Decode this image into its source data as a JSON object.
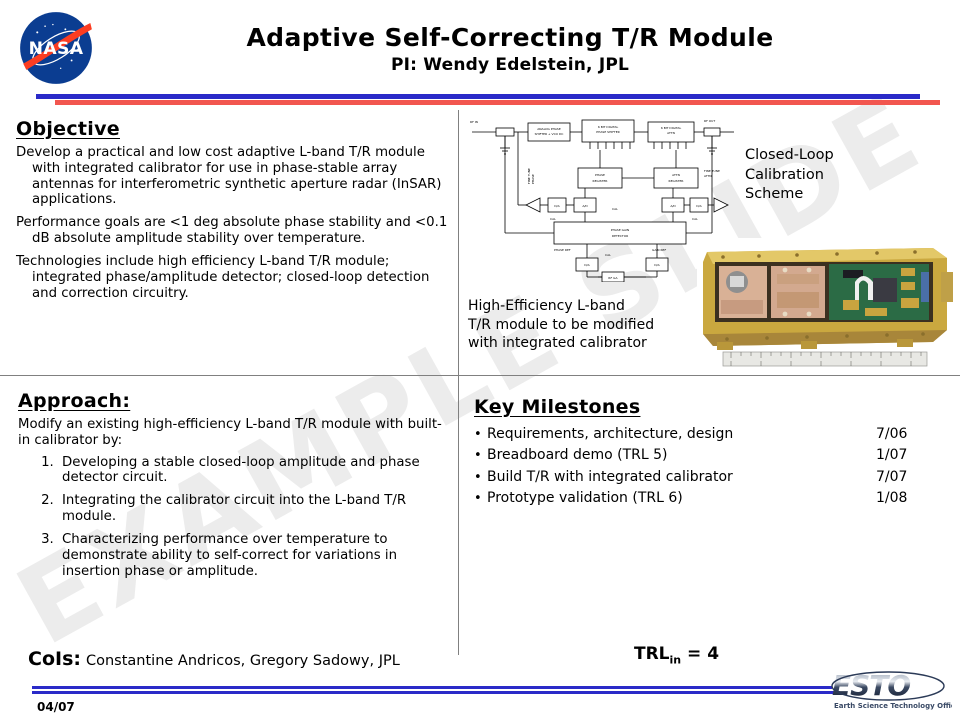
{
  "header": {
    "nasa_logo_alt": "NASA",
    "title": "Adaptive Self-Correcting T/R Module",
    "subtitle": "PI: Wendy Edelstein, JPL"
  },
  "watermark": {
    "text": "EXAMPLE SLIDE"
  },
  "objective": {
    "heading": "Objective",
    "paragraphs": [
      "Develop a practical and low cost  adaptive L-band T/R module with integrated calibrator for use in phase-stable array antennas for interferometric synthetic aperture radar (InSAR) applications.",
      "Performance goals are <1 deg absolute phase stability and <0.1 dB absolute amplitude stability over temperature.",
      "Technologies include high efficiency L-band T/R module; integrated phase/amplitude detector; closed-loop detection and correction circuitry."
    ]
  },
  "diagram": {
    "caption": "Closed-Loop\nCalibration\nScheme",
    "caption_lines": [
      "Closed-Loop",
      "Calibration",
      "Scheme"
    ],
    "ports": {
      "rf_in": "RF IN",
      "rf_out": "RF OUT"
    },
    "blocks": [
      "ANALOG PHASE SHIFTER + VCO DC",
      "6 BIT DIGITAL PHASE SHIFTER",
      "6 BIT DIGITAL ATTN",
      "ANALOG ATTN + VCA B",
      "PHASE REGISTER",
      "ATTN REGISTER",
      "PHASE GAIN DETECTOR",
      "RF GA"
    ],
    "small_labels": [
      "FINE TUNE PHASE",
      "FINE TUNE ATTN",
      "D/A",
      "A/D",
      "CAL",
      "PHASE REF",
      "GAIN REF",
      "SERIAL DATA"
    ]
  },
  "photo": {
    "alt": "High-efficiency L-band T/R module hardware photograph with ruler",
    "caption_lines": [
      "High-Efficiency L-band",
      "T/R module to be modified",
      "with integrated calibrator"
    ]
  },
  "approach": {
    "heading": "Approach:",
    "lead": "Modify an existing high-efficiency  L-band T/R module with built-in calibrator by:",
    "items": [
      "Developing a stable closed-loop amplitude and phase detector circuit.",
      "Integrating the calibrator circuit into the L-band T/R module.",
      "Characterizing performance over temperature to demonstrate ability to self-correct for variations in insertion phase or amplitude."
    ]
  },
  "milestones": {
    "heading": "Key Milestones",
    "bullet": "•",
    "rows": [
      {
        "label": "Requirements,  architecture,  design",
        "date": "7/06"
      },
      {
        "label": "Breadboard demo  (TRL 5)",
        "date": "1/07"
      },
      {
        "label": "Build T/R with integrated  calibrator",
        "date": "7/07"
      },
      {
        "label": "Prototype validation (TRL 6)",
        "date": "1/08"
      }
    ]
  },
  "cois": {
    "key": "CoIs:",
    "value": "Constantine  Andricos, Gregory Sadowy, JPL"
  },
  "trl": {
    "prefix": "TRL",
    "subscript": "in",
    "suffix": " = 4",
    "full": "TRLin = 4"
  },
  "footer": {
    "date": "04/07",
    "esto_name": "ESTO",
    "esto_tagline": "Earth Science Technology Office"
  },
  "colors": {
    "rule_blue": "#2a2ac8",
    "rule_red": "#f2564f",
    "divider_gray": "#808080",
    "watermark_gray": "#ececec",
    "nasa_blue": "#0b3d91",
    "nasa_red": "#fc3d21",
    "photo_gold": "#c9a441"
  }
}
